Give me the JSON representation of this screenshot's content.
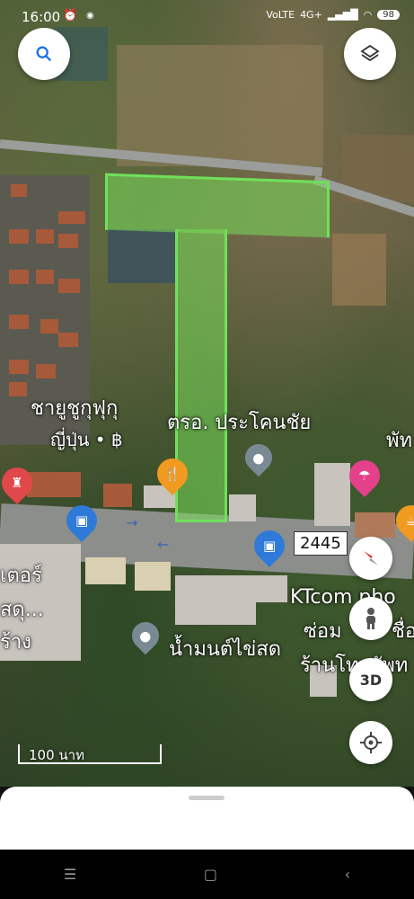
{
  "status_bar": {
    "time": "16:00",
    "indicators": [
      "VoLTE",
      "4G+",
      "signal",
      "wifi"
    ],
    "battery": "98"
  },
  "map": {
    "place_labels": {
      "shabu": "ชายูชูกุฟุกุ\nญี่ปุ่น • ฿",
      "shabu_line1": "ชายูชูกุฟุกุ",
      "shabu_line2": "ญี่ปุ่น • ฿",
      "police": "ตรอ. ประโคนชัย",
      "right_edge": "พัท",
      "left_store1": "เตอร์",
      "left_store2": "สดุ...",
      "left_store3": "ร้าง",
      "ktcom": "KTcom pho",
      "repair": "ซ่อม",
      "repair2": "ชื่อ",
      "phone_shop": "ร้านโทรศัพท",
      "water": "น้ำมนต์ไข่สด"
    },
    "route_shield": "2445",
    "scale_label": "100 นาท"
  },
  "controls": {
    "search": "search-icon",
    "layers": "layers-icon",
    "compass": "compass-icon",
    "street_view": "pegman-icon",
    "three_d": "3D",
    "locate": "my-location-icon"
  },
  "bottom_nav": {
    "menu": "☰",
    "home": "▢",
    "back": "‹"
  }
}
